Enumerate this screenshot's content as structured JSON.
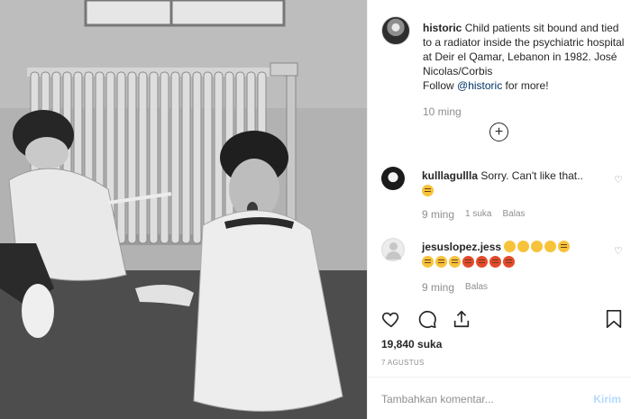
{
  "post": {
    "username": "historic",
    "caption_text": "Child patients sit bound and tied to a radiator inside the psychiatric hospital at Deir el Qamar, Lebanon in 1982. José Nicolas/Corbis",
    "follow_prefix": "Follow ",
    "follow_handle": "@historic",
    "follow_suffix": " for more!",
    "time": "10 ming"
  },
  "comments": [
    {
      "username": "kulllagullla",
      "text": "Sorry. Can't like that..",
      "emoji": [
        "worried-face"
      ],
      "time": "9 ming",
      "likes": "1 suka",
      "reply": "Balas"
    },
    {
      "username": "jesuslopez.jess",
      "emoji": [
        "screaming-face",
        "screaming-face",
        "screaming-face",
        "screaming-face",
        "worried-face",
        "worried-face",
        "expressionless-face",
        "expressionless-face",
        "angry-face",
        "angry-face",
        "angry-face",
        "angry-face"
      ],
      "time": "9 ming",
      "reply": "Balas"
    }
  ],
  "actions": {
    "like_icon": "heart-icon",
    "comment_icon": "comment-icon",
    "share_icon": "share-icon",
    "save_icon": "bookmark-icon"
  },
  "likes_count": "19,840 suka",
  "date": "7 AGUSTUS",
  "comment_box": {
    "placeholder": "Tambahkan komentar...",
    "post_label": "Kirim"
  },
  "colors": {
    "link": "#003569",
    "muted": "#8e8e8e",
    "post_disabled": "#b3dbff"
  }
}
